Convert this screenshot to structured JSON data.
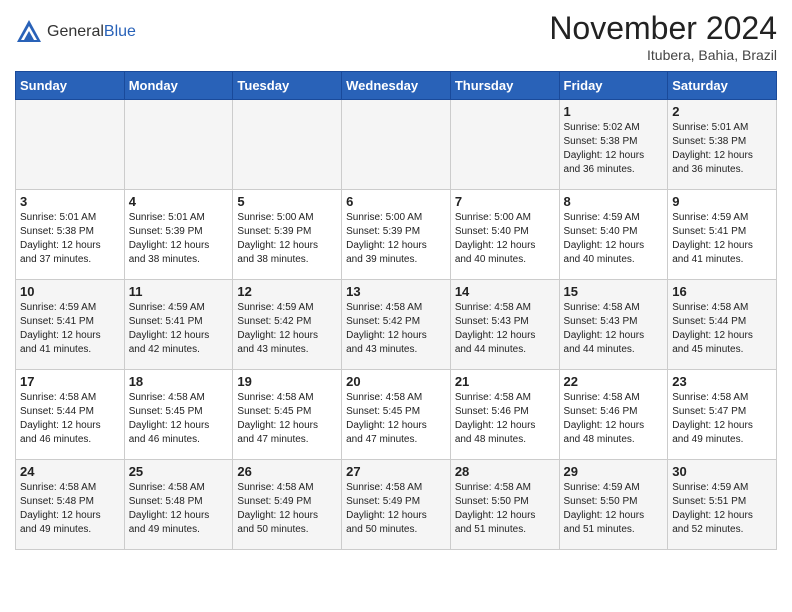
{
  "header": {
    "logo_general": "General",
    "logo_blue": "Blue",
    "month_title": "November 2024",
    "subtitle": "Itubera, Bahia, Brazil"
  },
  "days_of_week": [
    "Sunday",
    "Monday",
    "Tuesday",
    "Wednesday",
    "Thursday",
    "Friday",
    "Saturday"
  ],
  "weeks": [
    [
      {
        "day": "",
        "info": ""
      },
      {
        "day": "",
        "info": ""
      },
      {
        "day": "",
        "info": ""
      },
      {
        "day": "",
        "info": ""
      },
      {
        "day": "",
        "info": ""
      },
      {
        "day": "1",
        "info": "Sunrise: 5:02 AM\nSunset: 5:38 PM\nDaylight: 12 hours\nand 36 minutes."
      },
      {
        "day": "2",
        "info": "Sunrise: 5:01 AM\nSunset: 5:38 PM\nDaylight: 12 hours\nand 36 minutes."
      }
    ],
    [
      {
        "day": "3",
        "info": "Sunrise: 5:01 AM\nSunset: 5:38 PM\nDaylight: 12 hours\nand 37 minutes."
      },
      {
        "day": "4",
        "info": "Sunrise: 5:01 AM\nSunset: 5:39 PM\nDaylight: 12 hours\nand 38 minutes."
      },
      {
        "day": "5",
        "info": "Sunrise: 5:00 AM\nSunset: 5:39 PM\nDaylight: 12 hours\nand 38 minutes."
      },
      {
        "day": "6",
        "info": "Sunrise: 5:00 AM\nSunset: 5:39 PM\nDaylight: 12 hours\nand 39 minutes."
      },
      {
        "day": "7",
        "info": "Sunrise: 5:00 AM\nSunset: 5:40 PM\nDaylight: 12 hours\nand 40 minutes."
      },
      {
        "day": "8",
        "info": "Sunrise: 4:59 AM\nSunset: 5:40 PM\nDaylight: 12 hours\nand 40 minutes."
      },
      {
        "day": "9",
        "info": "Sunrise: 4:59 AM\nSunset: 5:41 PM\nDaylight: 12 hours\nand 41 minutes."
      }
    ],
    [
      {
        "day": "10",
        "info": "Sunrise: 4:59 AM\nSunset: 5:41 PM\nDaylight: 12 hours\nand 41 minutes."
      },
      {
        "day": "11",
        "info": "Sunrise: 4:59 AM\nSunset: 5:41 PM\nDaylight: 12 hours\nand 42 minutes."
      },
      {
        "day": "12",
        "info": "Sunrise: 4:59 AM\nSunset: 5:42 PM\nDaylight: 12 hours\nand 43 minutes."
      },
      {
        "day": "13",
        "info": "Sunrise: 4:58 AM\nSunset: 5:42 PM\nDaylight: 12 hours\nand 43 minutes."
      },
      {
        "day": "14",
        "info": "Sunrise: 4:58 AM\nSunset: 5:43 PM\nDaylight: 12 hours\nand 44 minutes."
      },
      {
        "day": "15",
        "info": "Sunrise: 4:58 AM\nSunset: 5:43 PM\nDaylight: 12 hours\nand 44 minutes."
      },
      {
        "day": "16",
        "info": "Sunrise: 4:58 AM\nSunset: 5:44 PM\nDaylight: 12 hours\nand 45 minutes."
      }
    ],
    [
      {
        "day": "17",
        "info": "Sunrise: 4:58 AM\nSunset: 5:44 PM\nDaylight: 12 hours\nand 46 minutes."
      },
      {
        "day": "18",
        "info": "Sunrise: 4:58 AM\nSunset: 5:45 PM\nDaylight: 12 hours\nand 46 minutes."
      },
      {
        "day": "19",
        "info": "Sunrise: 4:58 AM\nSunset: 5:45 PM\nDaylight: 12 hours\nand 47 minutes."
      },
      {
        "day": "20",
        "info": "Sunrise: 4:58 AM\nSunset: 5:45 PM\nDaylight: 12 hours\nand 47 minutes."
      },
      {
        "day": "21",
        "info": "Sunrise: 4:58 AM\nSunset: 5:46 PM\nDaylight: 12 hours\nand 48 minutes."
      },
      {
        "day": "22",
        "info": "Sunrise: 4:58 AM\nSunset: 5:46 PM\nDaylight: 12 hours\nand 48 minutes."
      },
      {
        "day": "23",
        "info": "Sunrise: 4:58 AM\nSunset: 5:47 PM\nDaylight: 12 hours\nand 49 minutes."
      }
    ],
    [
      {
        "day": "24",
        "info": "Sunrise: 4:58 AM\nSunset: 5:48 PM\nDaylight: 12 hours\nand 49 minutes."
      },
      {
        "day": "25",
        "info": "Sunrise: 4:58 AM\nSunset: 5:48 PM\nDaylight: 12 hours\nand 49 minutes."
      },
      {
        "day": "26",
        "info": "Sunrise: 4:58 AM\nSunset: 5:49 PM\nDaylight: 12 hours\nand 50 minutes."
      },
      {
        "day": "27",
        "info": "Sunrise: 4:58 AM\nSunset: 5:49 PM\nDaylight: 12 hours\nand 50 minutes."
      },
      {
        "day": "28",
        "info": "Sunrise: 4:58 AM\nSunset: 5:50 PM\nDaylight: 12 hours\nand 51 minutes."
      },
      {
        "day": "29",
        "info": "Sunrise: 4:59 AM\nSunset: 5:50 PM\nDaylight: 12 hours\nand 51 minutes."
      },
      {
        "day": "30",
        "info": "Sunrise: 4:59 AM\nSunset: 5:51 PM\nDaylight: 12 hours\nand 52 minutes."
      }
    ]
  ]
}
